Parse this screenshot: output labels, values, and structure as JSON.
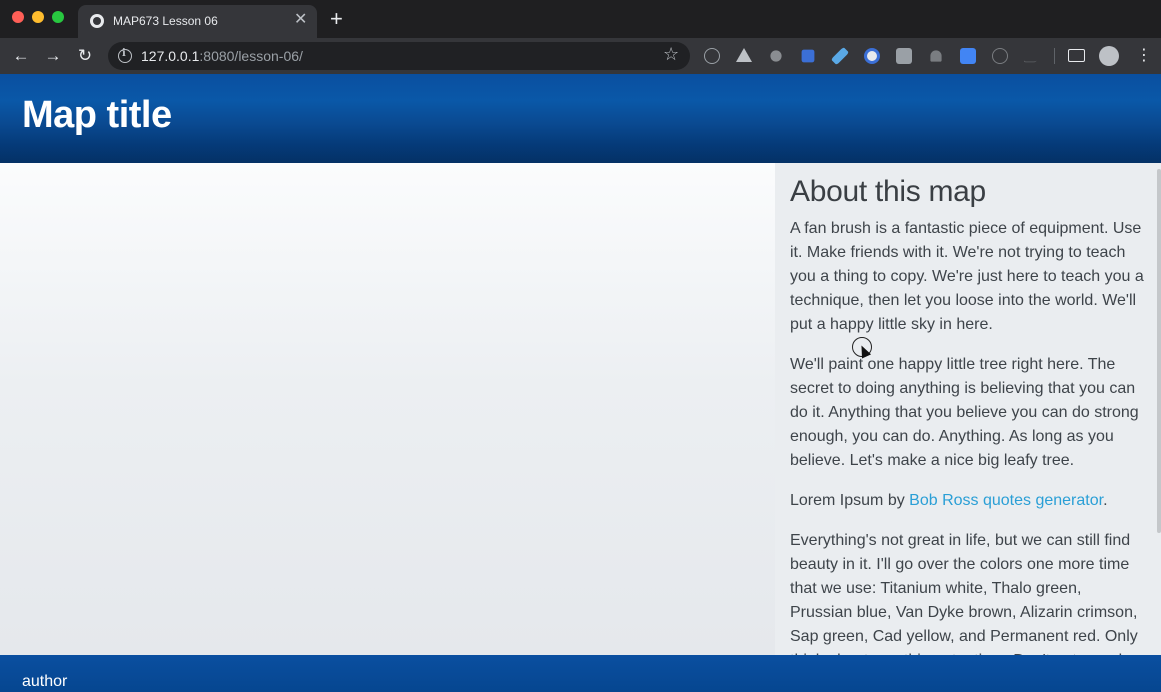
{
  "browser": {
    "tab_title": "MAP673 Lesson 06",
    "tab_close_glyph": "✕",
    "new_tab_glyph": "+",
    "back_glyph": "←",
    "forward_glyph": "→",
    "reload_glyph": "↻",
    "url_host": "127.0.0.1",
    "url_rest": ":8080/lesson-06/",
    "star_glyph": "☆",
    "menu_glyph": "⋮",
    "extension_icons": [
      "sync-icon",
      "drive-icon",
      "paw-icon",
      "bookmark-icon",
      "pen-icon",
      "lens-icon",
      "screen-icon",
      "flame-icon",
      "translate-icon",
      "info-icon",
      "m-icon"
    ],
    "colors": {
      "chrome_dark": "#1f1f21",
      "toolbar": "#35363a",
      "omnibox": "#202124"
    }
  },
  "site": {
    "title": "Map title",
    "footer_text": "author",
    "colors": {
      "header_blue": "#0a4fa0",
      "link": "#2a9fd6",
      "sidebar_bg": "#eaedf0"
    }
  },
  "sidebar": {
    "heading": "About this map",
    "paragraph_1": "A fan brush is a fantastic piece of equipment. Use it. Make friends with it. We're not trying to teach you a thing to copy. We're just here to teach you a technique, then let you loose into the world. We'll put a happy little sky in here.",
    "paragraph_2": "We'll paint one happy little tree right here. The secret to doing anything is believing that you can do it. Anything that you believe you can do strong enough, you can do. Anything. As long as you believe. Let's make a nice big leafy tree.",
    "credit_prefix": "Lorem Ipsum by ",
    "credit_link": "Bob Ross quotes generator",
    "credit_suffix": ".",
    "paragraph_4": "Everything's not great in life, but we can still find beauty in it. I'll go over the colors one more time that we use: Titanium white, Thalo green, Prussian blue, Van Dyke brown, Alizarin crimson, Sap green, Cad yellow, and Permanent red. Only think about one thing at a time. Don't get greedy."
  }
}
